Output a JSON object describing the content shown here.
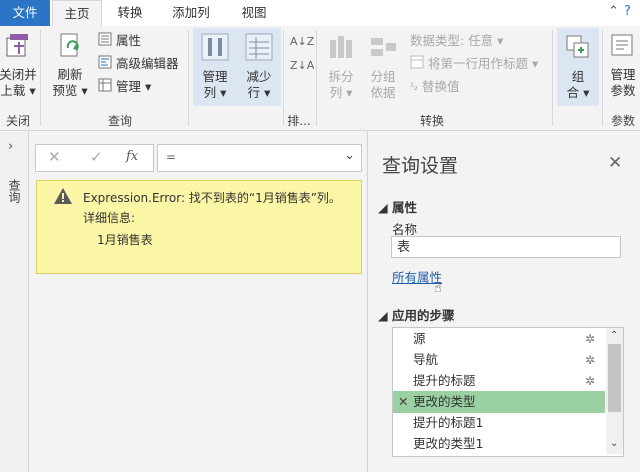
{
  "tabs": [
    "文件",
    "主页",
    "转换",
    "添加列",
    "视图"
  ],
  "ribbon": {
    "close_load": [
      "关闭并",
      "上载"
    ],
    "close_group": "关闭",
    "refresh_preview": [
      "刷新",
      "预览"
    ],
    "properties": "属性",
    "advanced_editor": "高级编辑器",
    "manage": "管理",
    "query_group": "查询",
    "manage_columns": [
      "管理",
      "列"
    ],
    "reduce_rows": [
      "减少",
      "行"
    ],
    "sort_group": "排...",
    "split_column": [
      "拆分",
      "列"
    ],
    "group_by": [
      "分组",
      "依据"
    ],
    "data_type": "数据类型: 任意",
    "use_first_row": "将第一行用作标题",
    "replace_values": "替换值",
    "transform_group": "转换",
    "combine": [
      "组",
      "合"
    ],
    "manage_params": [
      "管理",
      "参数"
    ],
    "params_group": "参数"
  },
  "sidebar_label": "查询",
  "formula": {
    "value": "=",
    "fx": "fx"
  },
  "error": {
    "line1": "Expression.Error: 找不到表的“1月销售表”列。",
    "line2": "详细信息:",
    "line3": "1月销售表"
  },
  "panel": {
    "title": "查询设置",
    "properties_heading": "属性",
    "name_label": "名称",
    "name_value": "表",
    "all_properties": "所有属性",
    "steps_heading": "应用的步骤",
    "steps": [
      "源",
      "导航",
      "提升的标题",
      "更改的类型",
      "提升的标题1",
      "更改的类型1"
    ]
  },
  "colors": {
    "file_tab": "#2b74c6",
    "error_bg": "#fbf5a6",
    "selected_step": "#9bd0a3",
    "link": "#1f5fa8"
  }
}
